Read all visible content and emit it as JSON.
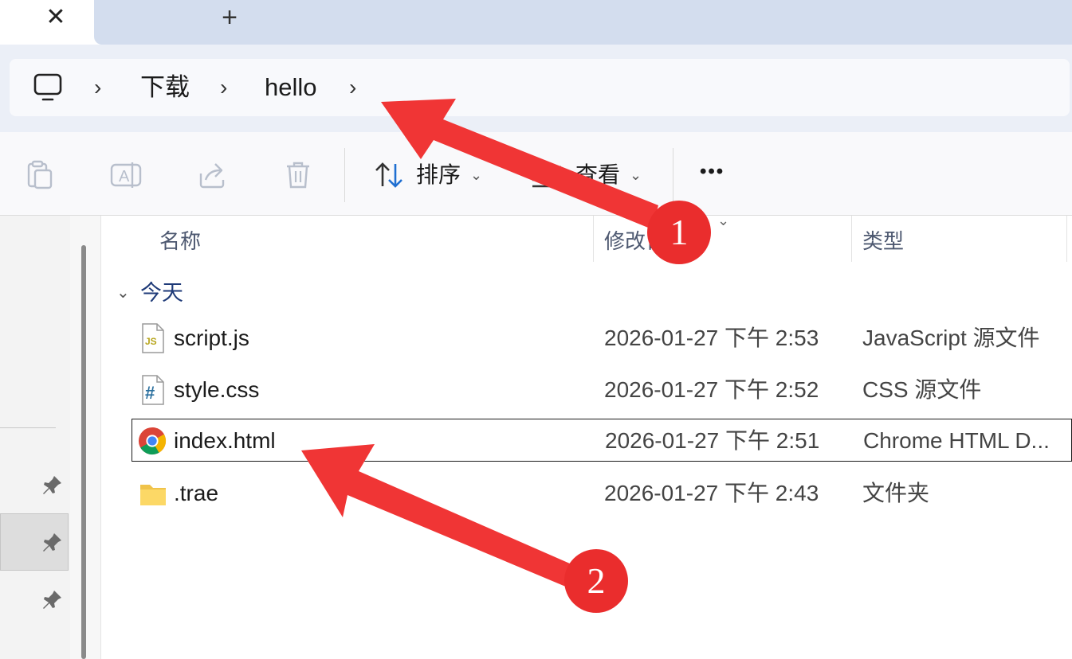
{
  "tabs": {
    "close_icon": "close-icon",
    "new_tab_icon": "plus-icon"
  },
  "address_bar": {
    "root_icon": "monitor-icon",
    "crumbs": [
      "下载",
      "hello"
    ]
  },
  "command_bar": {
    "sort_label": "排序",
    "view_label": "查看",
    "more_label": "•••"
  },
  "columns": {
    "name": "名称",
    "modified": "修改日",
    "type": "类型"
  },
  "group": {
    "label": "今天"
  },
  "files": [
    {
      "name": "script.js",
      "modified": "2026-01-27 下午 2:53",
      "type": "JavaScript 源文件",
      "icon": "js-file-icon"
    },
    {
      "name": "style.css",
      "modified": "2026-01-27 下午 2:52",
      "type": "CSS 源文件",
      "icon": "css-file-icon"
    },
    {
      "name": "index.html",
      "modified": "2026-01-27 下午 2:51",
      "type": "Chrome HTML D...",
      "icon": "chrome-html-icon",
      "selected": true
    },
    {
      "name": ".trae",
      "modified": "2026-01-27 下午 2:43",
      "type": "文件夹",
      "icon": "folder-icon"
    }
  ],
  "annotations": {
    "badge_1": "1",
    "badge_2": "2",
    "color": "#ea2d2d"
  }
}
